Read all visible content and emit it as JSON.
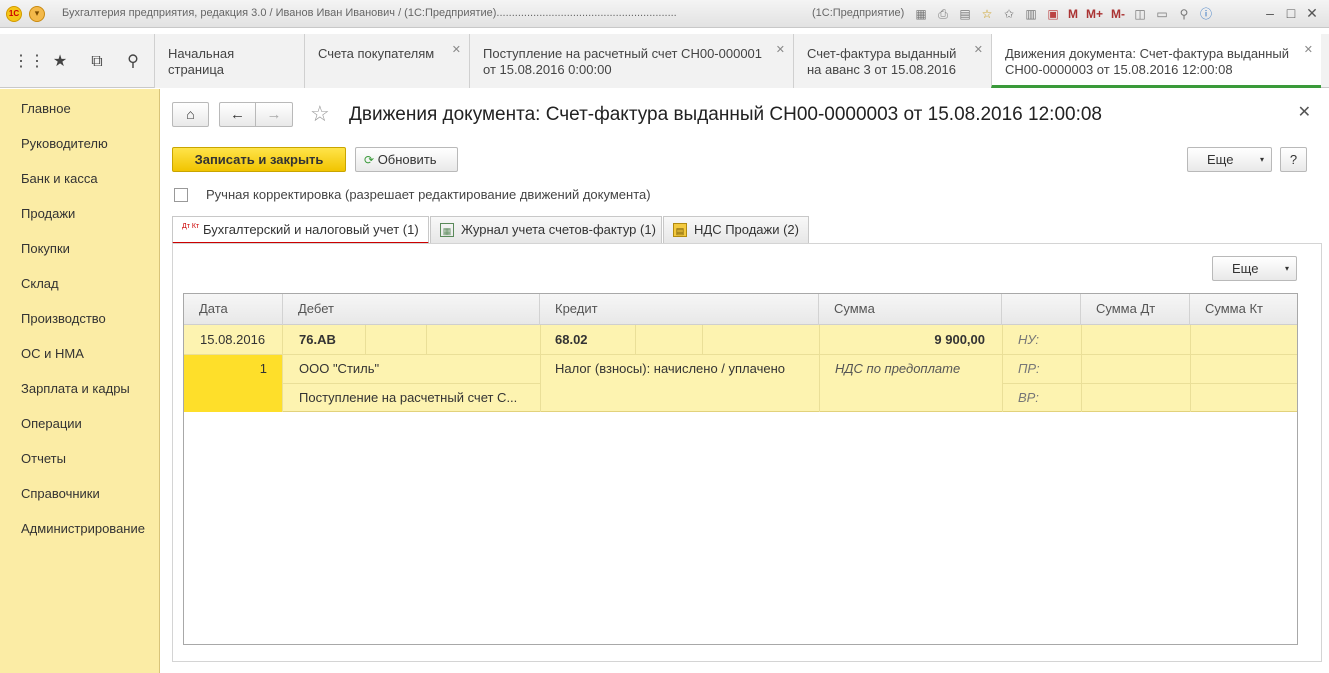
{
  "window": {
    "title": "Бухгалтерия предприятия, редакция 3.0 / Иванов Иван Иванович / (1С:Предприятие)...........................................................",
    "title_suffix": "(1С:Предприятие)",
    "icon_1c": "1С",
    "toolbar_m": "M",
    "toolbar_mplus": "M+",
    "toolbar_mminus": "M-"
  },
  "tabs": [
    {
      "label": "Начальная страница"
    },
    {
      "label": "Счета покупателям"
    },
    {
      "label": "Поступление на расчетный счет СН00-000001 от 15.08.2016 0:00:00"
    },
    {
      "label": "Счет-фактура выданный на аванс 3 от 15.08.2016"
    },
    {
      "label": "Движения документа: Счет-фактура выданный СН00-0000003 от 15.08.2016 12:00:08"
    }
  ],
  "sidebar": {
    "items": [
      "Главное",
      "Руководителю",
      "Банк и касса",
      "Продажи",
      "Покупки",
      "Склад",
      "Производство",
      "ОС и НМА",
      "Зарплата и кадры",
      "Операции",
      "Отчеты",
      "Справочники",
      "Администрирование"
    ]
  },
  "document": {
    "title": "Движения документа: Счет-фактура выданный СН00-0000003 от 15.08.2016 12:00:08",
    "save_close": "Записать и закрыть",
    "refresh": "Обновить",
    "more": "Еще",
    "help": "?",
    "manual_correction": "Ручная корректировка (разрешает редактирование движений документа)"
  },
  "subtabs": [
    {
      "label": "Бухгалтерский и налоговый учет (1)",
      "icon": "dt-kt-icon",
      "icon_text": "Дт Кт"
    },
    {
      "label": "Журнал учета счетов-фактур (1)",
      "icon": "table-icon"
    },
    {
      "label": "НДС Продажи (2)",
      "icon": "register-icon"
    }
  ],
  "table": {
    "more": "Еще",
    "columns": [
      "Дата",
      "Дебет",
      "Кредит",
      "Сумма",
      "",
      "Сумма Дт",
      "Сумма Кт"
    ],
    "row": {
      "date": "15.08.2016",
      "number": "1",
      "debit_account": "76.АВ",
      "debit_sub1": "ООО \"Стиль\"",
      "debit_sub2": "Поступление на расчетный счет С...",
      "credit_account": "68.02",
      "credit_sub1": "Налог (взносы): начислено / уплачено",
      "amount": "9 900,00",
      "content": "НДС по предоплате",
      "nu": "НУ:",
      "pr": "ПР:",
      "vr": "ВР:"
    }
  },
  "colors": {
    "sidebar_bg": "#fbeca5",
    "accent_yellow": "#f1c400",
    "row_bg": "#fdf3b0",
    "active_tab_underline": "#3a9a3a",
    "active_subtab_underline": "#cc0000"
  }
}
